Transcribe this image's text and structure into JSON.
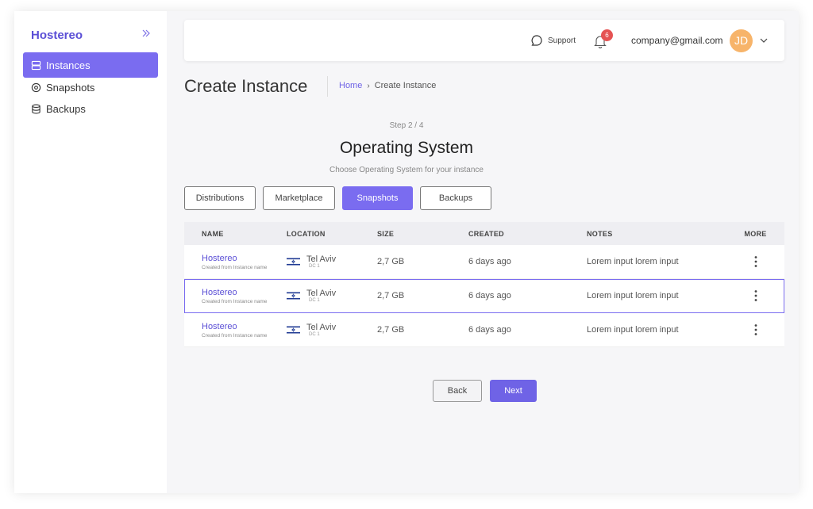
{
  "sidebar": {
    "brand": "Hostereo",
    "collapse_icon": "double-chevron-right-icon",
    "items": [
      {
        "label": "Instances",
        "icon": "server-icon",
        "active": true
      },
      {
        "label": "Snapshots",
        "icon": "disc-icon",
        "active": false
      },
      {
        "label": "Backups",
        "icon": "database-icon",
        "active": false
      }
    ]
  },
  "header": {
    "support_label": "Support",
    "notification_count": "6",
    "email": "company@gmail.com",
    "avatar_initials": "JD"
  },
  "page": {
    "title": "Create Instance",
    "breadcrumb": {
      "home": "Home",
      "separator": "›",
      "current": "Create Instance"
    }
  },
  "step": {
    "label": "Step 2 / 4",
    "title": "Operating System",
    "subtitle": "Choose Operating System for your instance"
  },
  "tabs": [
    {
      "label": "Distributions",
      "active": false
    },
    {
      "label": "Marketplace",
      "active": false
    },
    {
      "label": "Snapshots",
      "active": true
    },
    {
      "label": "Backups",
      "active": false
    }
  ],
  "table": {
    "headers": {
      "name": "NAME",
      "location": "LOCATION",
      "size": "SIZE",
      "created": "CREATED",
      "notes": "NOTES",
      "more": "MORE"
    },
    "rows": [
      {
        "name": "Hostereo",
        "sub": "Created from Instance name",
        "location": "Tel Aviv",
        "dc": "DC 1",
        "size": "2,7 GB",
        "created": "6 days ago",
        "notes": "Lorem input lorem input",
        "selected": false
      },
      {
        "name": "Hostereo",
        "sub": "Created from Instance name",
        "location": "Tel Aviv",
        "dc": "DC 1",
        "size": "2,7 GB",
        "created": "6 days ago",
        "notes": "Lorem input lorem input",
        "selected": true
      },
      {
        "name": "Hostereo",
        "sub": "Created from Instance name",
        "location": "Tel Aviv",
        "dc": "DC 1",
        "size": "2,7 GB",
        "created": "6 days ago",
        "notes": "Lorem input lorem input",
        "selected": false
      }
    ]
  },
  "actions": {
    "back": "Back",
    "next": "Next"
  },
  "colors": {
    "accent": "#7a6cf0",
    "brand": "#5b4fd6",
    "badge": "#e55353",
    "avatar": "#f7b46a"
  }
}
